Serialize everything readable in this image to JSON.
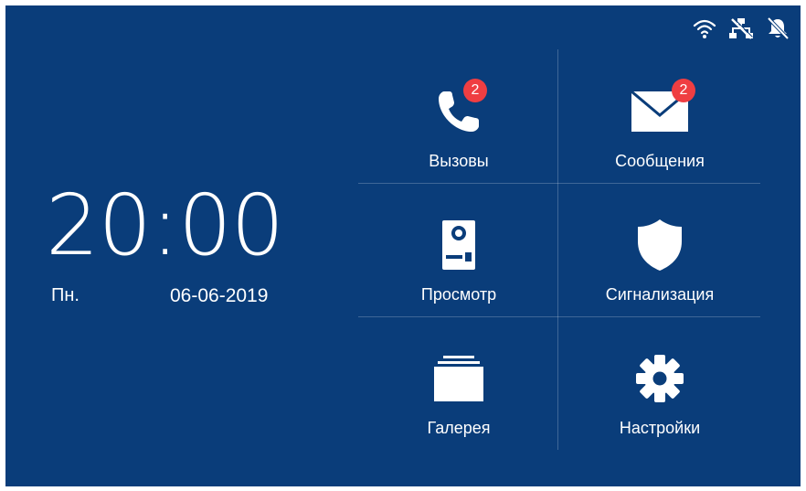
{
  "colors": {
    "background": "#0a3d7a",
    "foreground": "#ffffff",
    "badge": "#ef3e42"
  },
  "status_bar": {
    "icons": [
      "wifi-icon",
      "network-icon",
      "bell-off-icon"
    ]
  },
  "clock": {
    "time": "20:00",
    "day": "Пн.",
    "date": "06-06-2019"
  },
  "menu": {
    "calls": {
      "label": "Вызовы",
      "icon": "phone-icon",
      "badge": "2"
    },
    "messages": {
      "label": "Сообщения",
      "icon": "envelope-icon",
      "badge": "2"
    },
    "monitor": {
      "label": "Просмотр",
      "icon": "door-station-icon"
    },
    "alarm": {
      "label": "Сигнализация",
      "icon": "shield-icon"
    },
    "gallery": {
      "label": "Галерея",
      "icon": "gallery-icon"
    },
    "settings": {
      "label": "Настройки",
      "icon": "gear-icon"
    }
  }
}
